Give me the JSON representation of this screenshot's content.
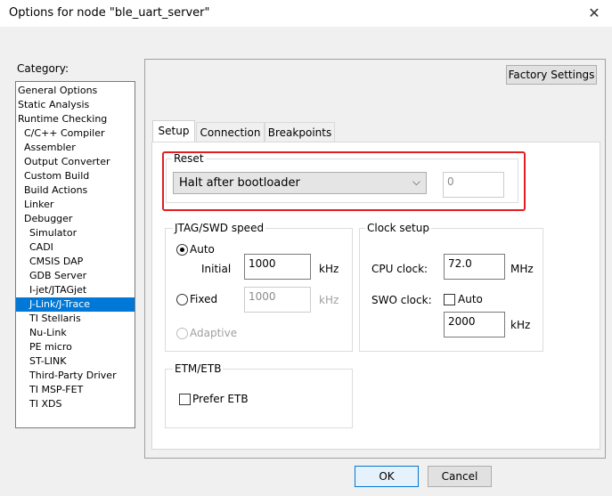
{
  "window": {
    "title": "Options for node \"ble_uart_server\""
  },
  "category": {
    "label": "Category:",
    "items": [
      {
        "label": "General Options",
        "level": 0
      },
      {
        "label": "Static Analysis",
        "level": 0
      },
      {
        "label": "Runtime Checking",
        "level": 0
      },
      {
        "label": "C/C++ Compiler",
        "level": 1
      },
      {
        "label": "Assembler",
        "level": 1
      },
      {
        "label": "Output Converter",
        "level": 1
      },
      {
        "label": "Custom Build",
        "level": 1
      },
      {
        "label": "Build Actions",
        "level": 1
      },
      {
        "label": "Linker",
        "level": 1
      },
      {
        "label": "Debugger",
        "level": 1
      },
      {
        "label": "Simulator",
        "level": 2
      },
      {
        "label": "CADI",
        "level": 2
      },
      {
        "label": "CMSIS DAP",
        "level": 2
      },
      {
        "label": "GDB Server",
        "level": 2
      },
      {
        "label": "I-jet/JTAGjet",
        "level": 2
      },
      {
        "label": "J-Link/J-Trace",
        "level": 2,
        "selected": true
      },
      {
        "label": "TI Stellaris",
        "level": 2
      },
      {
        "label": "Nu-Link",
        "level": 2
      },
      {
        "label": "PE micro",
        "level": 2
      },
      {
        "label": "ST-LINK",
        "level": 2
      },
      {
        "label": "Third-Party Driver",
        "level": 2
      },
      {
        "label": "TI MSP-FET",
        "level": 2
      },
      {
        "label": "TI XDS",
        "level": 2
      }
    ]
  },
  "factory_settings_label": "Factory Settings",
  "tabs": [
    {
      "label": "Setup",
      "active": true
    },
    {
      "label": "Connection"
    },
    {
      "label": "Breakpoints"
    }
  ],
  "reset": {
    "title": "Reset",
    "selected": "Halt after bootloader",
    "delay_value": "0"
  },
  "jtag": {
    "title": "JTAG/SWD speed",
    "auto_label": "Auto",
    "initial_label": "Initial",
    "initial_value": "1000",
    "initial_unit": "kHz",
    "fixed_label": "Fixed",
    "fixed_value": "1000",
    "fixed_unit": "kHz",
    "adaptive_label": "Adaptive"
  },
  "clock": {
    "title": "Clock setup",
    "cpu_label": "CPU clock:",
    "cpu_value": "72.0",
    "cpu_unit": "MHz",
    "swo_label": "SWO clock:",
    "swo_auto_label": "Auto",
    "swo_value": "2000",
    "swo_unit": "kHz"
  },
  "etm": {
    "title": "ETM/ETB",
    "prefer_label": "Prefer ETB"
  },
  "buttons": {
    "ok": "OK",
    "cancel": "Cancel"
  }
}
